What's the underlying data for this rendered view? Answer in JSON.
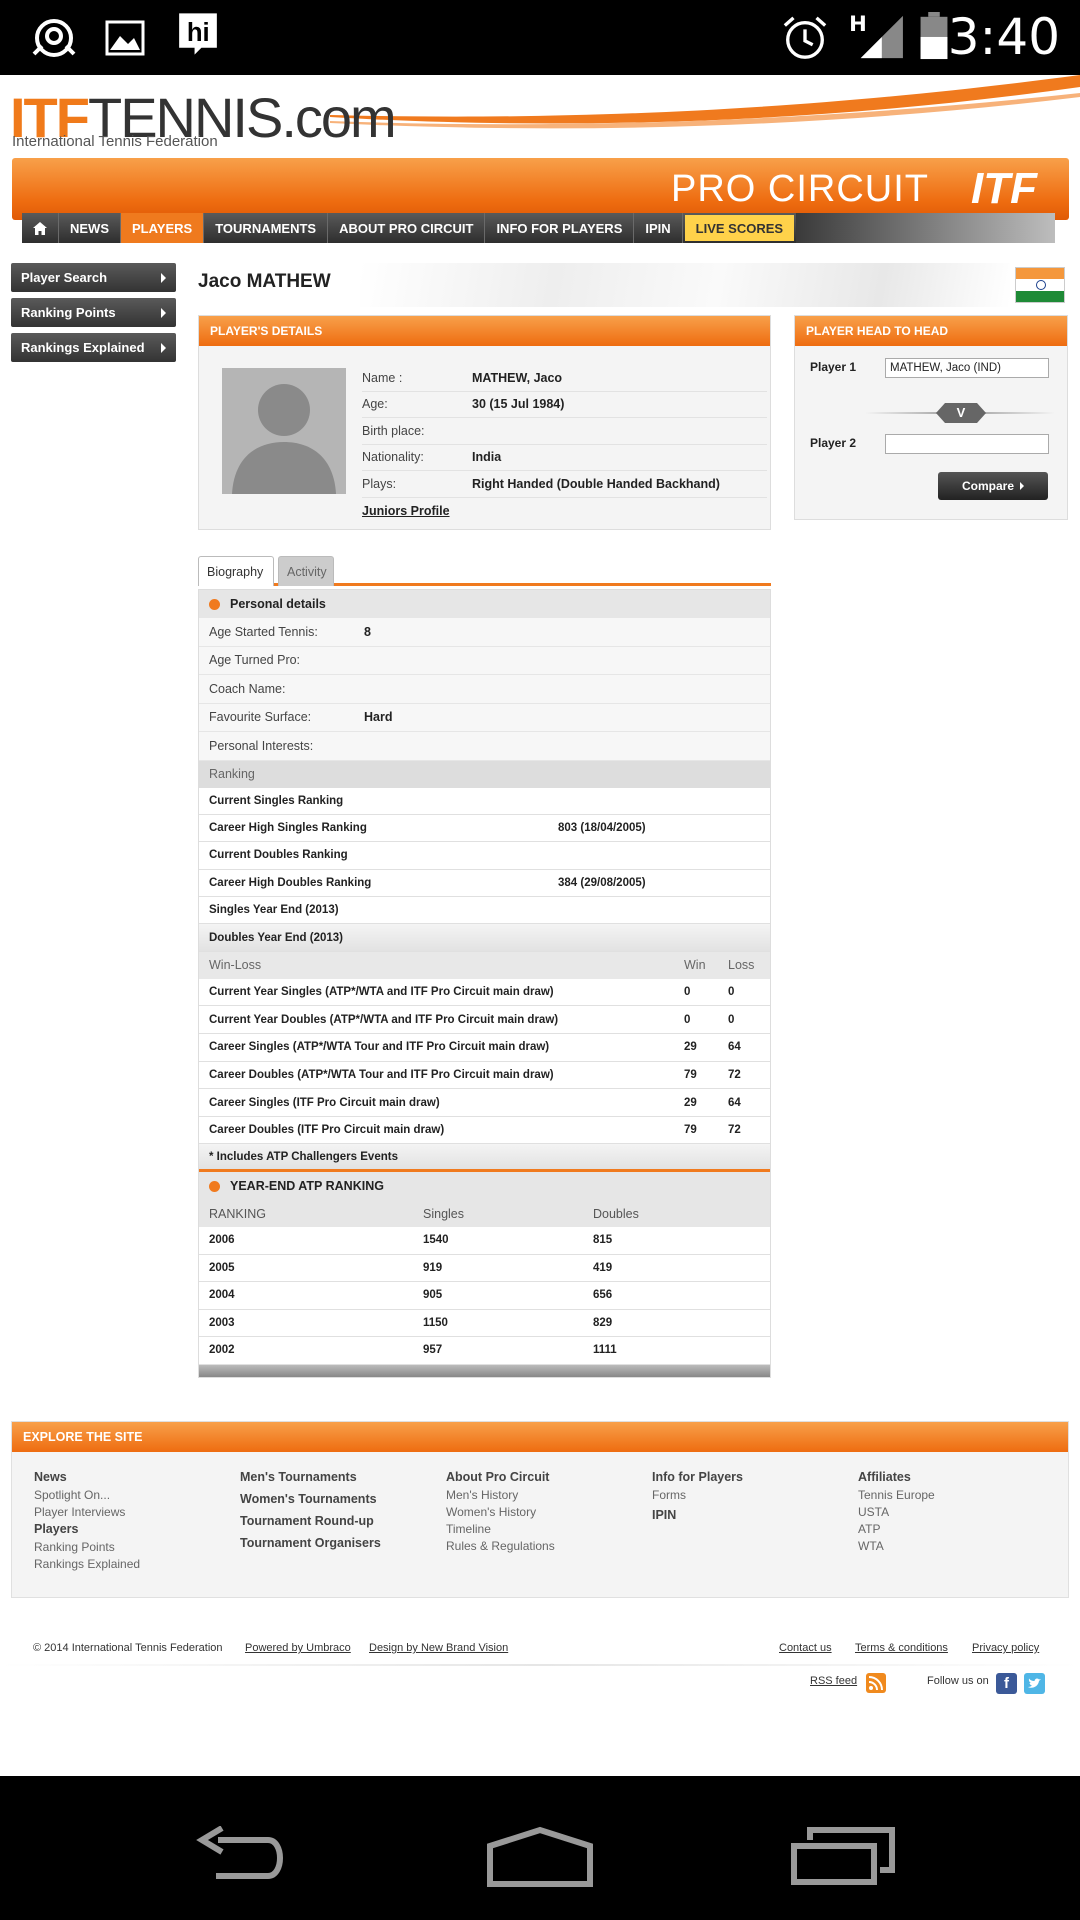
{
  "status_bar": {
    "time": "3:40",
    "signal_type": "H"
  },
  "site": {
    "logo_itf": "ITF",
    "logo_tennis": "TENNIS.com",
    "logo_sub": "International Tennis Federation",
    "banner_pro": "PRO CIRCUIT",
    "banner_itf": "ITF"
  },
  "nav": {
    "items": [
      "NEWS",
      "PLAYERS",
      "TOURNAMENTS",
      "ABOUT PRO CIRCUIT",
      "INFO FOR PLAYERS",
      "IPIN",
      "LIVE SCORES"
    ],
    "active": "PLAYERS"
  },
  "side_menu": [
    "Player Search",
    "Ranking Points",
    "Rankings Explained"
  ],
  "player": {
    "name": "Jaco MATHEW",
    "details_title": "PLAYER'S DETAILS",
    "fields": [
      {
        "label": "Name :",
        "value": "MATHEW, Jaco"
      },
      {
        "label": "Age:",
        "value": "30 (15 Jul 1984)"
      },
      {
        "label": "Birth place:",
        "value": ""
      },
      {
        "label": "Nationality:",
        "value": "India"
      },
      {
        "label": "Plays:",
        "value": "Right Handed (Double Handed Backhand)"
      }
    ],
    "juniors_link": "Juniors Profile"
  },
  "h2h": {
    "title": "PLAYER HEAD TO HEAD",
    "player1_label": "Player 1",
    "player1_value": "MATHEW, Jaco (IND)",
    "player2_label": "Player 2",
    "player2_value": "",
    "vs": "V",
    "compare": "Compare"
  },
  "tabs": {
    "biography": "Biography",
    "activity": "Activity"
  },
  "personal": {
    "title": "Personal details",
    "rows": [
      {
        "label": "Age Started Tennis:",
        "value": "8"
      },
      {
        "label": "Age Turned Pro:",
        "value": ""
      },
      {
        "label": "Coach Name:",
        "value": ""
      },
      {
        "label": "Favourite Surface:",
        "value": "Hard"
      },
      {
        "label": "Personal Interests:",
        "value": ""
      }
    ]
  },
  "ranking": {
    "title": "Ranking",
    "rows": [
      {
        "label": "Current Singles Ranking",
        "value": ""
      },
      {
        "label": "Career High Singles Ranking",
        "value": "803 (18/04/2005)"
      },
      {
        "label": "Current Doubles Ranking",
        "value": ""
      },
      {
        "label": "Career High Doubles Ranking",
        "value": "384 (29/08/2005)"
      },
      {
        "label": "Singles Year End (2013)",
        "value": ""
      }
    ],
    "doubles_year_end": "Doubles Year End (2013)"
  },
  "winloss": {
    "header": {
      "label": "Win-Loss",
      "win": "Win",
      "loss": "Loss"
    },
    "rows": [
      {
        "label": "Current Year Singles (ATP*/WTA and ITF Pro Circuit main draw)",
        "win": "0",
        "loss": "0"
      },
      {
        "label": "Current Year Doubles (ATP*/WTA and ITF Pro Circuit main draw)",
        "win": "0",
        "loss": "0"
      },
      {
        "label": "Career Singles (ATP*/WTA Tour and ITF Pro Circuit main draw)",
        "win": "29",
        "loss": "64"
      },
      {
        "label": "Career Doubles (ATP*/WTA Tour and ITF Pro Circuit main draw)",
        "win": "79",
        "loss": "72"
      },
      {
        "label": "Career Singles (ITF Pro Circuit main draw)",
        "win": "29",
        "loss": "64"
      },
      {
        "label": "Career Doubles (ITF Pro Circuit main draw)",
        "win": "79",
        "loss": "72"
      }
    ],
    "footnote": "* Includes ATP Challengers Events"
  },
  "year_end": {
    "title": "YEAR-END ATP RANKING",
    "header": {
      "c1": "RANKING",
      "c2": "Singles",
      "c3": "Doubles"
    },
    "rows": [
      {
        "year": "2006",
        "singles": "1540",
        "doubles": "815"
      },
      {
        "year": "2005",
        "singles": "919",
        "doubles": "419"
      },
      {
        "year": "2004",
        "singles": "905",
        "doubles": "656"
      },
      {
        "year": "2003",
        "singles": "1150",
        "doubles": "829"
      },
      {
        "year": "2002",
        "singles": "957",
        "doubles": "1111"
      }
    ]
  },
  "explore": {
    "title": "EXPLORE THE SITE",
    "col1": {
      "h1": "News",
      "l1": "Spotlight On...",
      "l2": "Player Interviews",
      "h2": "Players",
      "l3": "Ranking Points",
      "l4": "Rankings Explained"
    },
    "col2": [
      "Men's Tournaments",
      "Women's Tournaments",
      "Tournament Round-up",
      "Tournament Organisers"
    ],
    "col3": {
      "h": "About Pro Circuit",
      "links": [
        "Men's History",
        "Women's History",
        "Timeline",
        "Rules & Regulations"
      ]
    },
    "col4": {
      "h": "Info for Players",
      "l1": "Forms",
      "h2": "IPIN"
    },
    "col5": {
      "h": "Affiliates",
      "links": [
        "Tennis Europe",
        "USTA",
        "ATP",
        "WTA"
      ]
    }
  },
  "footer": {
    "copyright": "© 2014 International Tennis Federation",
    "powered": "Powered by Umbraco",
    "design": "Design by New Brand Vision",
    "contact": "Contact us",
    "terms": "Terms & conditions",
    "privacy": "Privacy policy",
    "rss": "RSS feed",
    "follow": "Follow us on"
  },
  "colors": {
    "accent": "#ef7a1e",
    "nav_dark": "#333333",
    "live": "#ffd24a"
  },
  "icons": [
    "hotspot-icon",
    "gallery-icon",
    "hi-app-icon",
    "alarm-icon",
    "signal-icon",
    "battery-icon",
    "home-icon",
    "back-icon",
    "home-nav-icon",
    "recents-icon",
    "rss-icon",
    "facebook-icon",
    "twitter-icon"
  ]
}
